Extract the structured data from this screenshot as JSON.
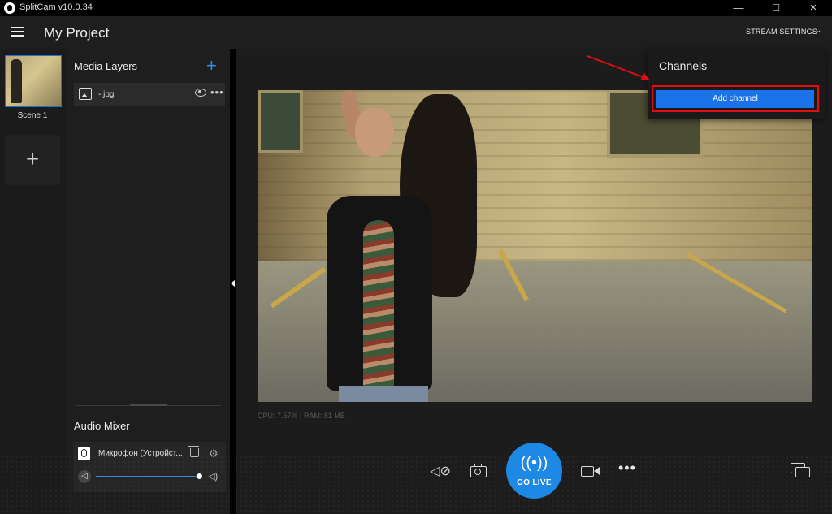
{
  "titlebar": {
    "app_title": "SplitCam v10.0.34",
    "minimize": "—",
    "maximize": "☐",
    "close": "✕"
  },
  "header": {
    "project_title": "My Project",
    "stream_settings_label": "STREAM SETTINGS"
  },
  "scenes": {
    "items": [
      {
        "label": "Scene 1"
      }
    ],
    "add_label": "+"
  },
  "media_layers": {
    "title": "Media Layers",
    "add_label": "+",
    "items": [
      {
        "name": "-.jpg"
      }
    ]
  },
  "audio_mixer": {
    "title": "Audio Mixer",
    "device_name": "Микрофон (Устройст...",
    "volume_percent": 100
  },
  "stats": {
    "cpu_ram": "CPU: 7.57% | RAM: 81 MB"
  },
  "controls": {
    "go_live_label": "GO LIVE"
  },
  "channels": {
    "title": "Channels",
    "add_channel_label": "Add channel"
  },
  "colors": {
    "accent": "#1e88e5",
    "highlight": "#e00d15"
  }
}
